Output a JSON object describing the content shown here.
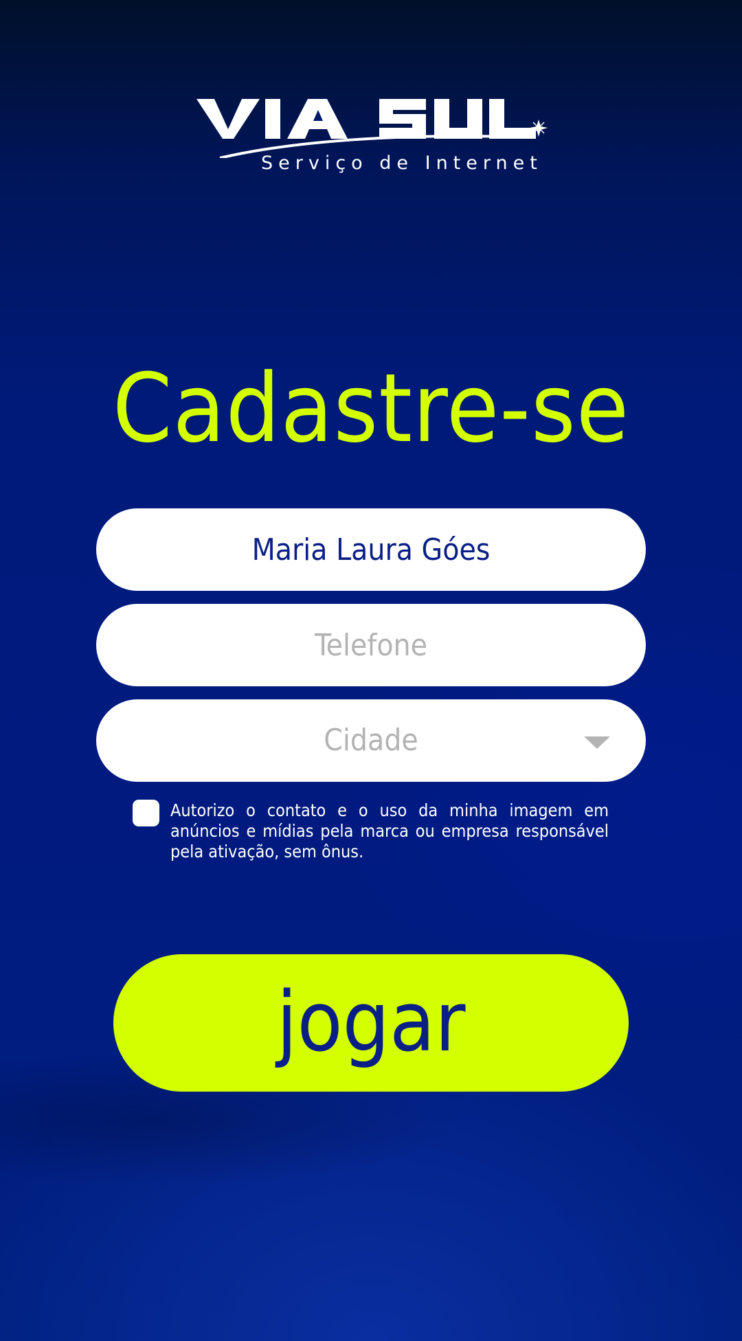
{
  "brand": {
    "name": "VIA SUL",
    "tagline": "Serviço de Internet"
  },
  "title": "Cadastre-se",
  "form": {
    "name_value": "Maria Laura Góes",
    "phone_placeholder": "Telefone",
    "city_placeholder": "Cidade",
    "consent_text": "Autorizo o contato e o uso da minha imagem em anúncios e mídias pela marca ou empresa responsável pela ativação, sem ônus.",
    "consent_checked": false
  },
  "play_button_label": "jogar",
  "colors": {
    "accent": "#d4ff00",
    "background": "#001a7a",
    "text_dark": "#0b1f86",
    "placeholder": "#b3b3b3"
  }
}
